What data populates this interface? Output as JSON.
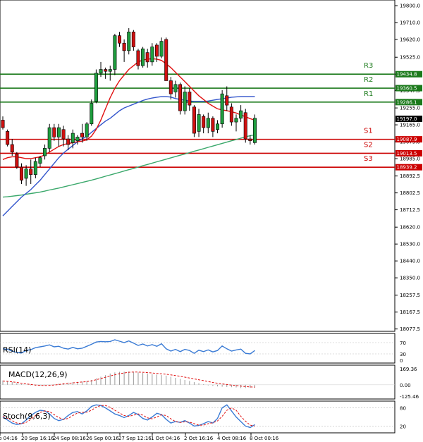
{
  "chart_data": {
    "type": "candlestick",
    "price_axis": {
      "ticks": [
        "19800.0",
        "19710.0",
        "19620.0",
        "19525.0",
        "19435.0",
        "19347.5",
        "19255.0",
        "19165.0",
        "19075.0",
        "18985.0",
        "18892.5",
        "18802.5",
        "18712.5",
        "18620.0",
        "18530.0",
        "18440.0",
        "18350.0",
        "18257.5",
        "18167.5",
        "18077.5"
      ],
      "range": [
        18065,
        19830
      ]
    },
    "x_axis": {
      "ticks": [
        "p 04:16",
        "20 Sep 16:16",
        "24 Sep 08:16",
        "26 Sep 00:16",
        "27 Sep 12:16",
        "1 Oct 04:16",
        "2 Oct 16:16",
        "4 Oct 08:16",
        "8 Oct 00:16"
      ]
    },
    "current_price": {
      "label": "19197.0",
      "value": 19197.0
    },
    "levels": [
      {
        "name": "R3",
        "value": 19434.8,
        "label": "19434.8",
        "color": "#1b7a1b"
      },
      {
        "name": "R2",
        "value": 19360.5,
        "label": "19360.5",
        "color": "#1b7a1b"
      },
      {
        "name": "R1",
        "value": 19286.1,
        "label": "19286.1",
        "color": "#1b7a1b"
      },
      {
        "name": "S1",
        "value": 19087.9,
        "label": "19087.9",
        "color": "#cc0000"
      },
      {
        "name": "S2",
        "value": 19013.5,
        "label": "19013.5",
        "color": "#cc0000"
      },
      {
        "name": "S3",
        "value": 18939.2,
        "label": "18939.2",
        "color": "#cc0000"
      }
    ],
    "candles": [
      [
        19190,
        19210,
        19140,
        19150
      ],
      [
        19130,
        19140,
        19050,
        19060
      ],
      [
        19060,
        19090,
        19000,
        19020
      ],
      [
        19010,
        19020,
        18930,
        18940
      ],
      [
        18940,
        18960,
        18850,
        18870
      ],
      [
        18880,
        18950,
        18840,
        18930
      ],
      [
        18930,
        18980,
        18850,
        18900
      ],
      [
        18900,
        18990,
        18880,
        18970
      ],
      [
        18960,
        19000,
        18940,
        18990
      ],
      [
        19000,
        19060,
        18980,
        19040
      ],
      [
        19040,
        19170,
        19020,
        19150
      ],
      [
        19150,
        19170,
        19080,
        19100
      ],
      [
        19100,
        19170,
        19050,
        19150
      ],
      [
        19140,
        19160,
        19050,
        19090
      ],
      [
        19090,
        19110,
        19030,
        19060
      ],
      [
        19070,
        19140,
        19040,
        19120
      ],
      [
        19080,
        19110,
        19060,
        19100
      ],
      [
        19120,
        19170,
        19070,
        19100
      ],
      [
        19100,
        19180,
        19080,
        19170
      ],
      [
        19170,
        19300,
        19160,
        19280
      ],
      [
        19290,
        19460,
        19280,
        19440
      ],
      [
        19440,
        19500,
        19420,
        19460
      ],
      [
        19460,
        19470,
        19410,
        19450
      ],
      [
        19450,
        19480,
        19400,
        19460
      ],
      [
        19460,
        19650,
        19430,
        19640
      ],
      [
        19640,
        19660,
        19580,
        19600
      ],
      [
        19600,
        19620,
        19500,
        19560
      ],
      [
        19560,
        19680,
        19540,
        19660
      ],
      [
        19660,
        19670,
        19560,
        19580
      ],
      [
        19560,
        19570,
        19460,
        19480
      ],
      [
        19480,
        19580,
        19470,
        19570
      ],
      [
        19550,
        19570,
        19470,
        19500
      ],
      [
        19500,
        19600,
        19480,
        19580
      ],
      [
        19590,
        19600,
        19500,
        19530
      ],
      [
        19530,
        19630,
        19520,
        19610
      ],
      [
        19620,
        19630,
        19500,
        19400
      ],
      [
        19400,
        19420,
        19300,
        19330
      ],
      [
        19340,
        19400,
        19310,
        19380
      ],
      [
        19380,
        19390,
        19220,
        19240
      ],
      [
        19240,
        19370,
        19220,
        19340
      ],
      [
        19340,
        19360,
        19240,
        19270
      ],
      [
        19260,
        19270,
        19100,
        19120
      ],
      [
        19130,
        19250,
        19100,
        19220
      ],
      [
        19210,
        19220,
        19120,
        19150
      ],
      [
        19150,
        19230,
        19120,
        19200
      ],
      [
        19200,
        19210,
        19100,
        19130
      ],
      [
        19140,
        19190,
        19120,
        19170
      ],
      [
        19170,
        19350,
        19150,
        19330
      ],
      [
        19320,
        19370,
        19240,
        19270
      ],
      [
        19260,
        19280,
        19160,
        19180
      ],
      [
        19180,
        19220,
        19130,
        19200
      ],
      [
        19200,
        19270,
        19180,
        19240
      ],
      [
        19230,
        19250,
        19070,
        19090
      ],
      [
        19090,
        19110,
        19060,
        19080
      ],
      [
        19070,
        19220,
        19060,
        19200
      ]
    ],
    "ma_red": [
      18980,
      18990,
      18995,
      18995,
      18990,
      18985,
      18985,
      18990,
      18995,
      19005,
      19020,
      19035,
      19050,
      19060,
      19065,
      19070,
      19075,
      19078,
      19085,
      19105,
      19140,
      19190,
      19250,
      19310,
      19360,
      19400,
      19430,
      19460,
      19480,
      19500,
      19510,
      19515,
      19517,
      19515,
      19508,
      19490,
      19470,
      19445,
      19420,
      19395,
      19370,
      19345,
      19320,
      19300,
      19280,
      19265,
      19250,
      19245,
      19240,
      19235,
      19228,
      19218,
      19208,
      19198,
      19190
    ],
    "ma_blue": [
      18680,
      18705,
      18730,
      18755,
      18780,
      18800,
      18820,
      18845,
      18870,
      18900,
      18930,
      18960,
      18990,
      19015,
      19035,
      19055,
      19075,
      19090,
      19105,
      19125,
      19145,
      19165,
      19185,
      19200,
      19220,
      19240,
      19255,
      19265,
      19275,
      19285,
      19295,
      19302,
      19308,
      19312,
      19315,
      19315,
      19313,
      19305,
      19300,
      19296,
      19292,
      19290,
      19290,
      19290,
      19292,
      19296,
      19300,
      19304,
      19308,
      19312,
      19314,
      19316,
      19316,
      19316,
      19316
    ],
    "ma_green": [
      18780,
      18782,
      18785,
      18788,
      18791,
      18795,
      18799,
      18803,
      18807,
      18812,
      18818,
      18823,
      18828,
      18834,
      18840,
      18846,
      18852,
      18858,
      18864,
      18870,
      18877,
      18884,
      18891,
      18898,
      18905,
      18912,
      18919,
      18926,
      18933,
      18940,
      18947,
      18954,
      18961,
      18968,
      18975,
      18982,
      18989,
      18996,
      19003,
      19010,
      19017,
      19024,
      19031,
      19038,
      19045,
      19052,
      19059,
      19066,
      19073,
      19080,
      19087,
      19094,
      19101,
      19107,
      19112
    ],
    "rsi": {
      "label": "RSI(14)",
      "ticks": [
        "70",
        "30",
        "0"
      ],
      "range": [
        0,
        100
      ],
      "values": [
        48,
        46,
        40,
        35,
        33,
        42,
        45,
        52,
        55,
        58,
        62,
        55,
        57,
        50,
        47,
        53,
        48,
        50,
        57,
        64,
        72,
        74,
        73,
        74,
        80,
        75,
        70,
        76,
        68,
        60,
        65,
        58,
        63,
        57,
        66,
        48,
        40,
        46,
        38,
        46,
        42,
        32,
        43,
        38,
        44,
        37,
        42,
        58,
        48,
        40,
        44,
        47,
        32,
        30,
        42
      ]
    },
    "macd": {
      "label": "MACD(12,26,9)",
      "ticks": [
        "169.36",
        "0.00",
        "-125.46"
      ],
      "range": [
        -125.46,
        169.36
      ],
      "hist": [
        40,
        35,
        25,
        15,
        5,
        0,
        -5,
        -8,
        -8,
        -6,
        -2,
        5,
        10,
        15,
        20,
        25,
        28,
        30,
        35,
        45,
        60,
        75,
        90,
        105,
        115,
        120,
        122,
        124,
        120,
        115,
        110,
        105,
        100,
        95,
        90,
        85,
        75,
        65,
        55,
        45,
        35,
        25,
        15,
        5,
        -5,
        -10,
        -15,
        -18,
        -20,
        -22,
        -25,
        -30,
        -30,
        -28,
        -25
      ],
      "signal": [
        35,
        32,
        28,
        22,
        15,
        8,
        3,
        -2,
        -5,
        -6,
        -5,
        -2,
        3,
        8,
        13,
        18,
        22,
        26,
        30,
        37,
        47,
        58,
        70,
        82,
        93,
        103,
        110,
        116,
        118,
        118,
        116,
        113,
        110,
        106,
        102,
        98,
        92,
        86,
        79,
        71,
        63,
        55,
        47,
        39,
        30,
        22,
        14,
        8,
        3,
        -2,
        -7,
        -12,
        -17,
        -20,
        -22
      ]
    },
    "stoch": {
      "label": "Stoch(9,6,3)",
      "ticks": [
        "80",
        "20"
      ],
      "range": [
        0,
        100
      ],
      "k": [
        50,
        40,
        30,
        25,
        28,
        40,
        55,
        65,
        72,
        70,
        60,
        45,
        38,
        42,
        55,
        65,
        68,
        60,
        70,
        85,
        90,
        88,
        80,
        70,
        60,
        55,
        48,
        55,
        65,
        58,
        45,
        40,
        50,
        62,
        58,
        42,
        30,
        35,
        32,
        38,
        30,
        20,
        22,
        28,
        35,
        30,
        45,
        80,
        90,
        70,
        50,
        35,
        20,
        15,
        25
      ],
      "d": [
        52,
        45,
        38,
        30,
        28,
        32,
        42,
        55,
        65,
        70,
        68,
        58,
        48,
        42,
        45,
        55,
        63,
        65,
        66,
        72,
        82,
        88,
        88,
        82,
        72,
        63,
        55,
        52,
        56,
        60,
        56,
        47,
        44,
        50,
        57,
        55,
        44,
        35,
        32,
        34,
        33,
        28,
        23,
        23,
        28,
        31,
        37,
        52,
        72,
        80,
        72,
        52,
        36,
        23,
        20
      ]
    }
  }
}
